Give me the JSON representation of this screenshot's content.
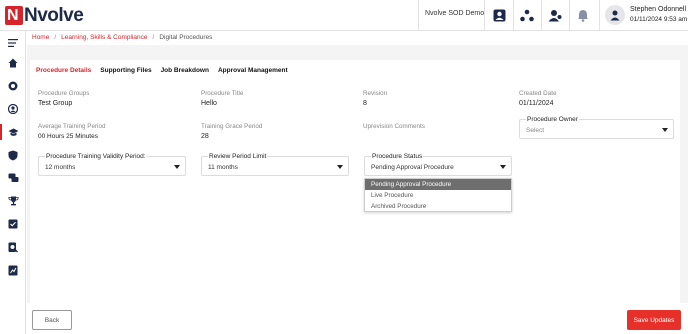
{
  "header": {
    "logo_text": "Nvolve",
    "logo_letter": "N",
    "org_name": "Nvolve SOD Demo",
    "user_name": "Stephen Odonnell",
    "user_time": "01/11/2024 9:53 am"
  },
  "breadcrumb": {
    "home": "Home",
    "section": "Learning, Skills & Compliance",
    "current": "Digital Procedures",
    "separator": "/"
  },
  "tabs": [
    {
      "label": "Procedure Details",
      "active": true
    },
    {
      "label": "Supporting Files",
      "active": false
    },
    {
      "label": "Job Breakdown",
      "active": false
    },
    {
      "label": "Approval Management",
      "active": false
    }
  ],
  "fields": {
    "procedure_groups": {
      "label": "Procedure Groups",
      "value": "Test Group"
    },
    "procedure_title": {
      "label": "Procedure Title",
      "value": "Hello"
    },
    "revision": {
      "label": "Revision",
      "value": "8"
    },
    "created_date": {
      "label": "Created Date",
      "value": "01/11/2024"
    },
    "average_training_period": {
      "label": "Average Training Period",
      "value": "00 Hours 25 Minutes"
    },
    "training_grace_period": {
      "label": "Training Grace Period",
      "value": "28"
    },
    "upreviosion_comments": {
      "label": "Uprevision Comments",
      "value": ""
    }
  },
  "selects": {
    "procedure_owner": {
      "label": "Procedure Owner",
      "value": "Select"
    },
    "validity_period": {
      "label": "Procedure Training Validity Period:",
      "value": "12 months"
    },
    "review_period": {
      "label": "Review Period Limit",
      "value": "11 months"
    },
    "procedure_status": {
      "label": "Procedure Status",
      "value": "Pending Approval Procedure"
    }
  },
  "status_options": [
    {
      "label": "Pending Approval Procedure",
      "selected": true
    },
    {
      "label": "Live Procedure",
      "selected": false
    },
    {
      "label": "Archived Procedure",
      "selected": false
    }
  ],
  "buttons": {
    "back": "Back",
    "save": "Save Updates"
  },
  "colors": {
    "brand_red": "#d6242a",
    "save_red": "#e8302b",
    "navy": "#1e2a4a"
  }
}
